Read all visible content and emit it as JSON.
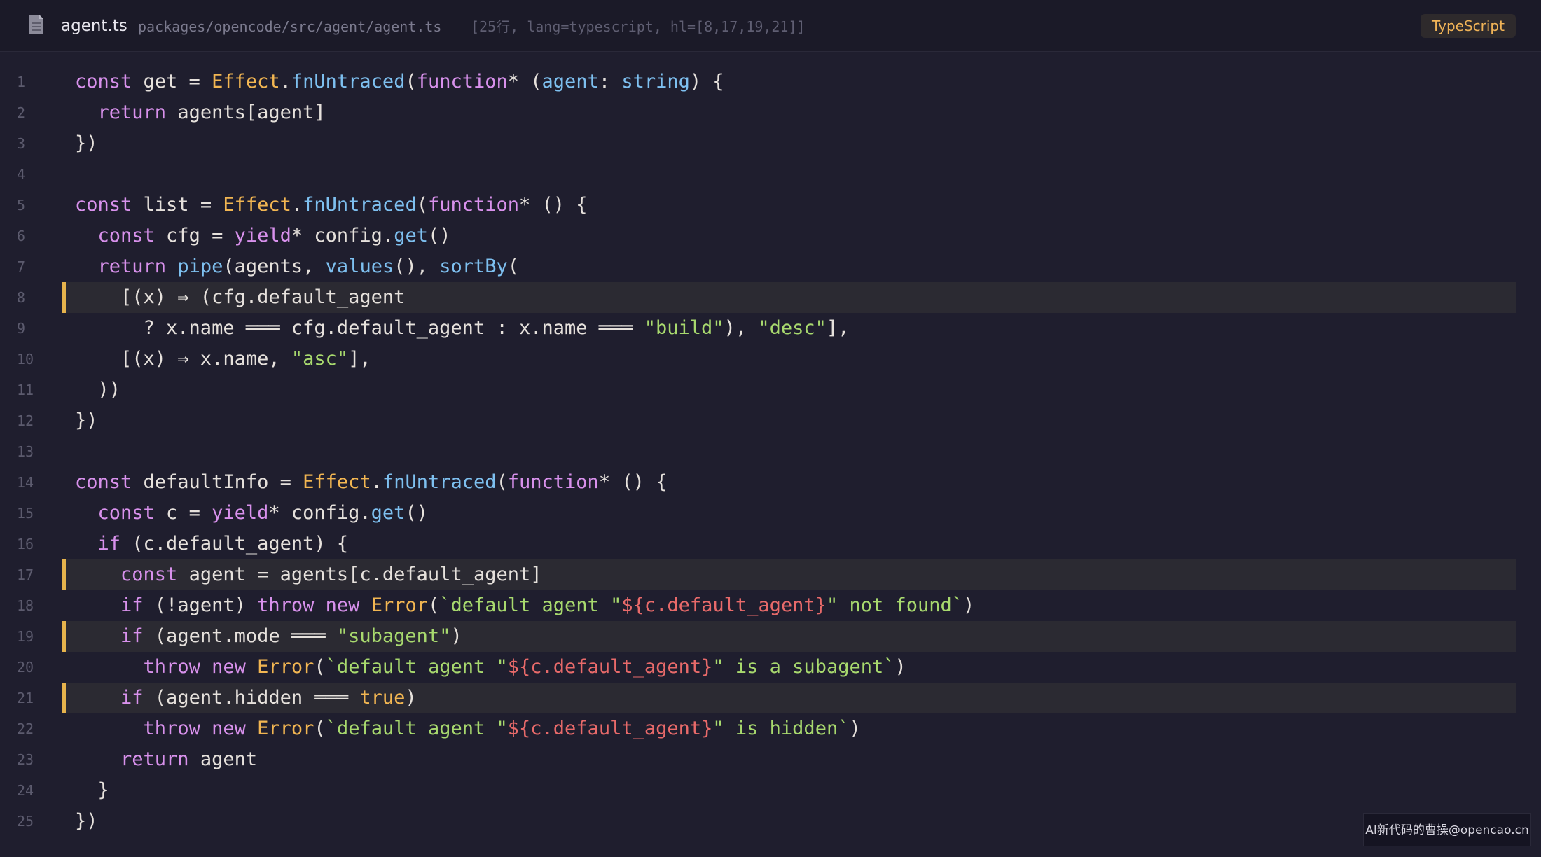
{
  "header": {
    "file_name": "agent.ts",
    "file_path": "packages/opencode/src/agent/agent.ts",
    "file_meta": "[25行, lang=typescript, hl=[8,17,19,21]]",
    "language_badge": "TypeScript"
  },
  "code": {
    "highlighted_lines": [
      8,
      17,
      19,
      21
    ],
    "lines": [
      {
        "n": "1",
        "tokens": [
          [
            "kw",
            "const"
          ],
          [
            "pl",
            " get = "
          ],
          [
            "cl",
            "Effect"
          ],
          [
            "pl",
            "."
          ],
          [
            "fn",
            "fnUntraced"
          ],
          [
            "pl",
            "("
          ],
          [
            "kw",
            "function"
          ],
          [
            "pl",
            "* ("
          ],
          [
            "fn",
            "agent"
          ],
          [
            "pl",
            ": "
          ],
          [
            "fn",
            "string"
          ],
          [
            "pl",
            ") {"
          ]
        ]
      },
      {
        "n": "2",
        "tokens": [
          [
            "pl",
            "  "
          ],
          [
            "kw",
            "return"
          ],
          [
            "pl",
            " agents[agent]"
          ]
        ]
      },
      {
        "n": "3",
        "tokens": [
          [
            "pl",
            "})"
          ]
        ]
      },
      {
        "n": "4",
        "tokens": []
      },
      {
        "n": "5",
        "tokens": [
          [
            "kw",
            "const"
          ],
          [
            "pl",
            " list = "
          ],
          [
            "cl",
            "Effect"
          ],
          [
            "pl",
            "."
          ],
          [
            "fn",
            "fnUntraced"
          ],
          [
            "pl",
            "("
          ],
          [
            "kw",
            "function"
          ],
          [
            "pl",
            "* () {"
          ]
        ]
      },
      {
        "n": "6",
        "tokens": [
          [
            "pl",
            "  "
          ],
          [
            "kw",
            "const"
          ],
          [
            "pl",
            " cfg = "
          ],
          [
            "kw",
            "yield"
          ],
          [
            "pl",
            "* config."
          ],
          [
            "fn",
            "get"
          ],
          [
            "pl",
            "()"
          ]
        ]
      },
      {
        "n": "7",
        "tokens": [
          [
            "pl",
            "  "
          ],
          [
            "kw",
            "return"
          ],
          [
            "pl",
            " "
          ],
          [
            "fn",
            "pipe"
          ],
          [
            "pl",
            "(agents, "
          ],
          [
            "fn",
            "values"
          ],
          [
            "pl",
            "(), "
          ],
          [
            "fn",
            "sortBy"
          ],
          [
            "pl",
            "("
          ]
        ]
      },
      {
        "n": "8",
        "tokens": [
          [
            "pl",
            "    [(x) ⇒ (cfg.default_agent"
          ]
        ]
      },
      {
        "n": "9",
        "tokens": [
          [
            "pl",
            "      ? x.name ═══ cfg.default_agent : x.name ═══ "
          ],
          [
            "st",
            "\"build\""
          ],
          [
            "pl",
            "), "
          ],
          [
            "st",
            "\"desc\""
          ],
          [
            "pl",
            "],"
          ]
        ]
      },
      {
        "n": "10",
        "tokens": [
          [
            "pl",
            "    [(x) ⇒ x.name, "
          ],
          [
            "st",
            "\"asc\""
          ],
          [
            "pl",
            "],"
          ]
        ]
      },
      {
        "n": "11",
        "tokens": [
          [
            "pl",
            "  ))"
          ]
        ]
      },
      {
        "n": "12",
        "tokens": [
          [
            "pl",
            "})"
          ]
        ]
      },
      {
        "n": "13",
        "tokens": []
      },
      {
        "n": "14",
        "tokens": [
          [
            "kw",
            "const"
          ],
          [
            "pl",
            " defaultInfo = "
          ],
          [
            "cl",
            "Effect"
          ],
          [
            "pl",
            "."
          ],
          [
            "fn",
            "fnUntraced"
          ],
          [
            "pl",
            "("
          ],
          [
            "kw",
            "function"
          ],
          [
            "pl",
            "* () {"
          ]
        ]
      },
      {
        "n": "15",
        "tokens": [
          [
            "pl",
            "  "
          ],
          [
            "kw",
            "const"
          ],
          [
            "pl",
            " c = "
          ],
          [
            "kw",
            "yield"
          ],
          [
            "pl",
            "* config."
          ],
          [
            "fn",
            "get"
          ],
          [
            "pl",
            "()"
          ]
        ]
      },
      {
        "n": "16",
        "tokens": [
          [
            "pl",
            "  "
          ],
          [
            "kw",
            "if"
          ],
          [
            "pl",
            " (c.default_agent) {"
          ]
        ]
      },
      {
        "n": "17",
        "tokens": [
          [
            "pl",
            "    "
          ],
          [
            "kw",
            "const"
          ],
          [
            "pl",
            " agent = agents[c.default_agent]"
          ]
        ]
      },
      {
        "n": "18",
        "tokens": [
          [
            "pl",
            "    "
          ],
          [
            "kw",
            "if"
          ],
          [
            "pl",
            " (!agent) "
          ],
          [
            "kw",
            "throw"
          ],
          [
            "pl",
            " "
          ],
          [
            "kw",
            "new"
          ],
          [
            "pl",
            " "
          ],
          [
            "cl",
            "Error"
          ],
          [
            "pl",
            "("
          ],
          [
            "st",
            "`default agent \""
          ],
          [
            "tp",
            "${c.default_agent}"
          ],
          [
            "st",
            "\" not found`"
          ],
          [
            "pl",
            ")"
          ]
        ]
      },
      {
        "n": "19",
        "tokens": [
          [
            "pl",
            "    "
          ],
          [
            "kw",
            "if"
          ],
          [
            "pl",
            " (agent.mode ═══ "
          ],
          [
            "st",
            "\"subagent\""
          ],
          [
            "pl",
            ")"
          ]
        ]
      },
      {
        "n": "20",
        "tokens": [
          [
            "pl",
            "      "
          ],
          [
            "kw",
            "throw"
          ],
          [
            "pl",
            " "
          ],
          [
            "kw",
            "new"
          ],
          [
            "pl",
            " "
          ],
          [
            "cl",
            "Error"
          ],
          [
            "pl",
            "("
          ],
          [
            "st",
            "`default agent \""
          ],
          [
            "tp",
            "${c.default_agent}"
          ],
          [
            "st",
            "\" is a subagent`"
          ],
          [
            "pl",
            ")"
          ]
        ]
      },
      {
        "n": "21",
        "tokens": [
          [
            "pl",
            "    "
          ],
          [
            "kw",
            "if"
          ],
          [
            "pl",
            " (agent.hidden ═══ "
          ],
          [
            "cl",
            "true"
          ],
          [
            "pl",
            ")"
          ]
        ]
      },
      {
        "n": "22",
        "tokens": [
          [
            "pl",
            "      "
          ],
          [
            "kw",
            "throw"
          ],
          [
            "pl",
            " "
          ],
          [
            "kw",
            "new"
          ],
          [
            "pl",
            " "
          ],
          [
            "cl",
            "Error"
          ],
          [
            "pl",
            "("
          ],
          [
            "st",
            "`default agent \""
          ],
          [
            "tp",
            "${c.default_agent}"
          ],
          [
            "st",
            "\" is hidden`"
          ],
          [
            "pl",
            ")"
          ]
        ]
      },
      {
        "n": "23",
        "tokens": [
          [
            "pl",
            "    "
          ],
          [
            "kw",
            "return"
          ],
          [
            "pl",
            " agent"
          ]
        ]
      },
      {
        "n": "24",
        "tokens": [
          [
            "pl",
            "  }"
          ]
        ]
      },
      {
        "n": "25",
        "tokens": [
          [
            "pl",
            "})"
          ]
        ]
      }
    ]
  },
  "watermark": "AI新代码的曹操@opencao.cn",
  "colors": {
    "background": "#1f1e2e",
    "keyword": "#d891ec",
    "function": "#7ec0f0",
    "class": "#f2b652",
    "string": "#a8d96e",
    "template_expr": "#e86a6a",
    "highlight_bar": "#e6b34c"
  },
  "icons": {
    "file": "file-document-icon"
  }
}
